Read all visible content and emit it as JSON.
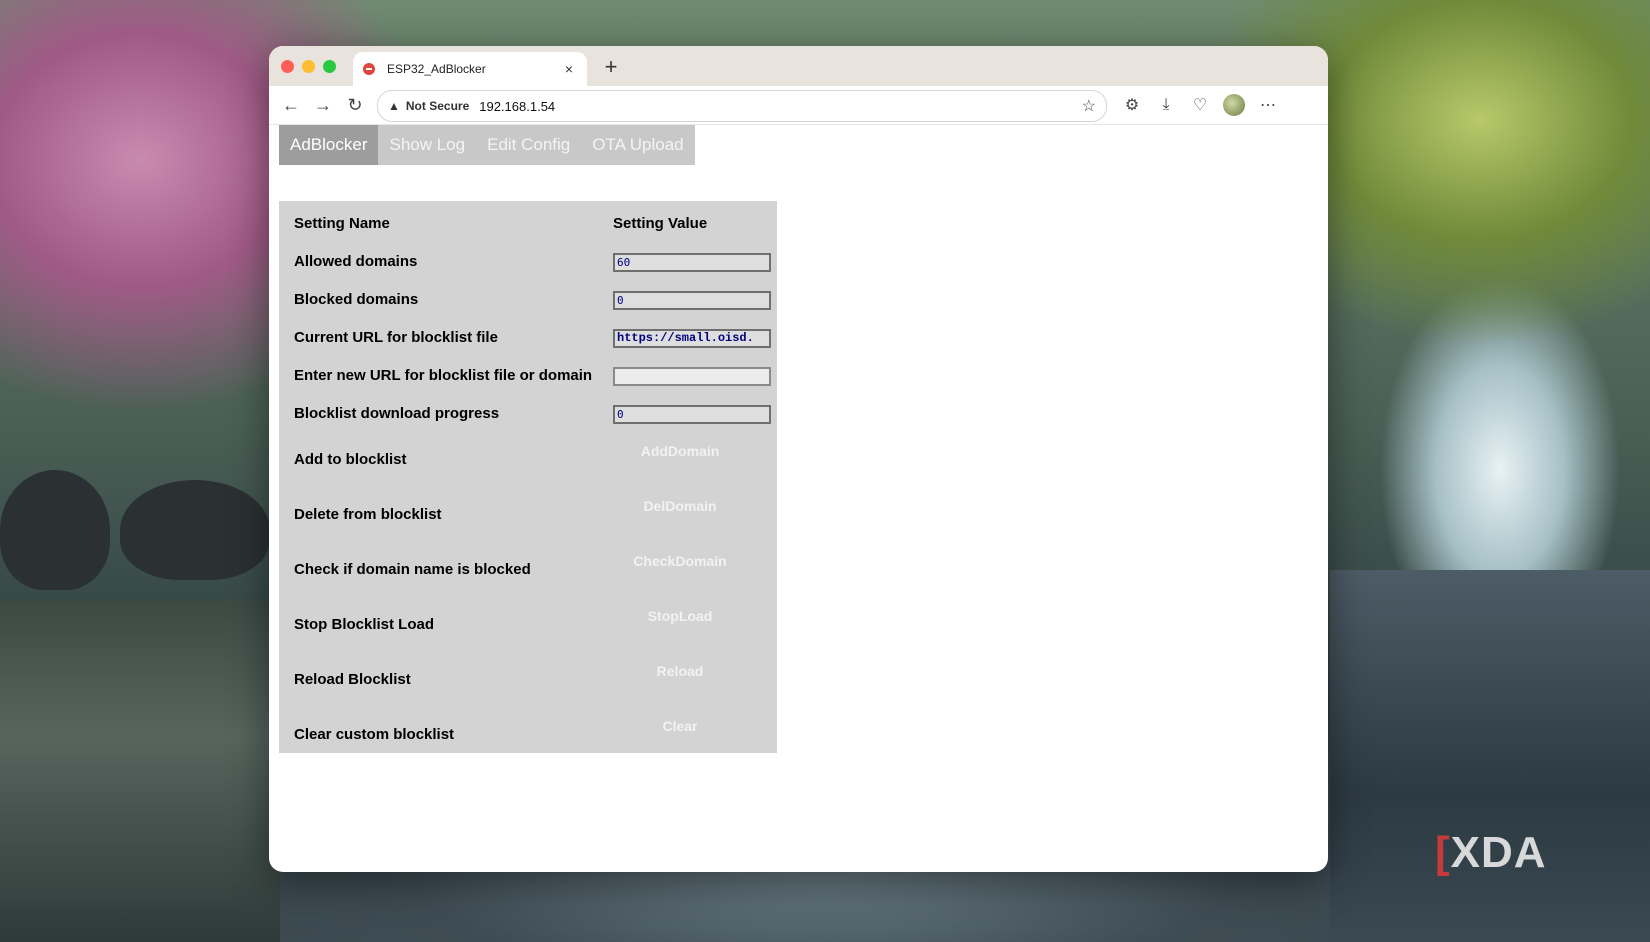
{
  "browser": {
    "tab_title": "ESP32_AdBlocker",
    "tab_close": "×",
    "new_tab": "+",
    "security_label": "Not Secure",
    "url": "192.168.1.54"
  },
  "nav": {
    "tabs": [
      {
        "label": "AdBlocker",
        "active": true
      },
      {
        "label": "Show Log",
        "active": false
      },
      {
        "label": "Edit Config",
        "active": false
      },
      {
        "label": "OTA Upload",
        "active": false
      }
    ]
  },
  "settings": {
    "header_name": "Setting Name",
    "header_value": "Setting Value",
    "fields": [
      {
        "label": "Allowed domains",
        "value": "60"
      },
      {
        "label": "Blocked domains",
        "value": "0"
      },
      {
        "label": "Current URL for blocklist file",
        "value": "https://small.oisd."
      },
      {
        "label": "Enter new URL for blocklist file or domain",
        "value": ""
      },
      {
        "label": "Blocklist download progress",
        "value": "0"
      }
    ],
    "actions": [
      {
        "label": "Add to blocklist",
        "button": "AddDomain"
      },
      {
        "label": "Delete from blocklist",
        "button": "DelDomain"
      },
      {
        "label": "Check if domain name is blocked",
        "button": "CheckDomain"
      },
      {
        "label": "Stop Blocklist Load",
        "button": "StopLoad"
      },
      {
        "label": "Reload Blocklist",
        "button": "Reload"
      },
      {
        "label": "Clear custom blocklist",
        "button": "Clear"
      }
    ]
  },
  "watermark": {
    "text": "XDA"
  }
}
